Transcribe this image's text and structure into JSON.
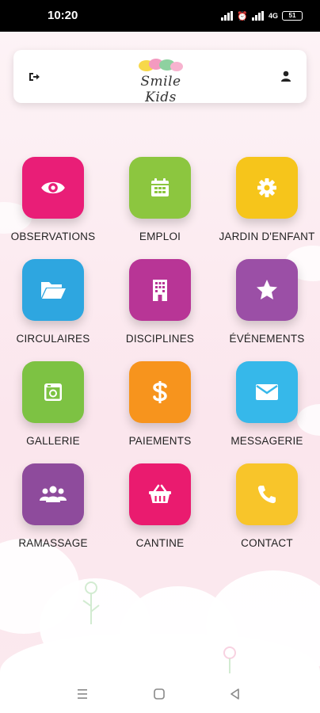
{
  "status_bar": {
    "time": "10:20",
    "battery": "51",
    "network": "4G"
  },
  "header": {
    "logo_text": "Smile Kids"
  },
  "menu": [
    {
      "label": "OBSERVATIONS",
      "icon": "eye-icon",
      "color": "#e91e77"
    },
    {
      "label": "EMPLOI",
      "icon": "calendar-icon",
      "color": "#8cc63f"
    },
    {
      "label": "JARDIN D'ENFANT",
      "icon": "gear-icon",
      "color": "#f6c51b"
    },
    {
      "label": "CIRCULAIRES",
      "icon": "folder-open-icon",
      "color": "#2ea6e0"
    },
    {
      "label": "DISCIPLINES",
      "icon": "building-icon",
      "color": "#b83596"
    },
    {
      "label": "ÉVÉNEMENTS",
      "icon": "star-icon",
      "color": "#9b4fa6"
    },
    {
      "label": "GALLERIE",
      "icon": "photo-icon",
      "color": "#7dc243"
    },
    {
      "label": "PAIEMENTS",
      "icon": "dollar-icon",
      "color": "#f7941d"
    },
    {
      "label": "MESSAGERIE",
      "icon": "envelope-icon",
      "color": "#36b8ea"
    },
    {
      "label": "RAMASSAGE",
      "icon": "users-icon",
      "color": "#8e4b9c"
    },
    {
      "label": "CANTINE",
      "icon": "basket-icon",
      "color": "#ea1b6f"
    },
    {
      "label": "CONTACT",
      "icon": "phone-icon",
      "color": "#f8c52a"
    }
  ]
}
